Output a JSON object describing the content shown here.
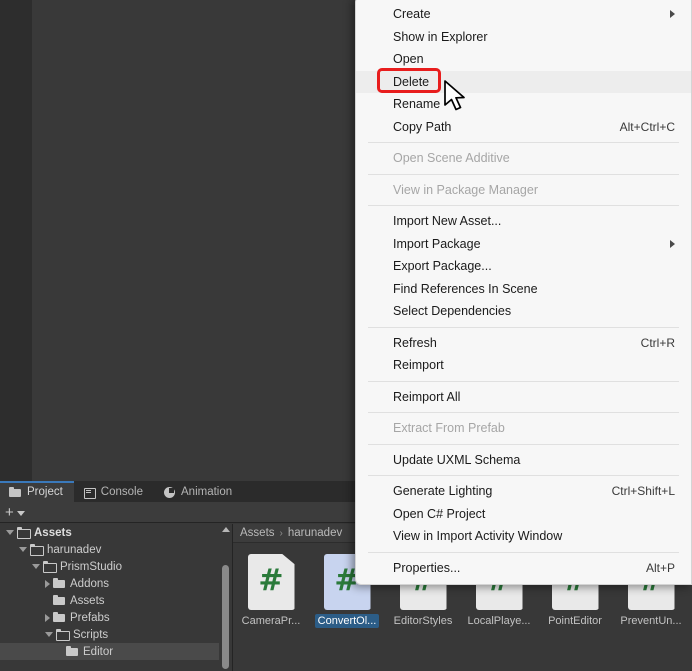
{
  "window": {
    "scene_bg_color": "#393939",
    "panel_bg_color": "#2d2d2d"
  },
  "dock": {
    "tabs": [
      {
        "label": "Project",
        "icon": "folder-icon",
        "active": true
      },
      {
        "label": "Console",
        "icon": "console-icon",
        "active": false
      },
      {
        "label": "Animation",
        "icon": "clock-icon",
        "active": false
      }
    ],
    "toolbar": {
      "create_label": "+",
      "dropdown_icon": "chevron-down-icon"
    }
  },
  "tree": {
    "items": [
      {
        "label": "Assets",
        "depth": 0,
        "twisty": "open",
        "selected": false,
        "bold": true,
        "folder": "open"
      },
      {
        "label": "harunadev",
        "depth": 1,
        "twisty": "open",
        "selected": false,
        "bold": false,
        "folder": "open"
      },
      {
        "label": "PrismStudio",
        "depth": 2,
        "twisty": "open",
        "selected": false,
        "bold": false,
        "folder": "open"
      },
      {
        "label": "Addons",
        "depth": 3,
        "twisty": "closed",
        "selected": false,
        "bold": false,
        "folder": "closed"
      },
      {
        "label": "Assets",
        "depth": 3,
        "twisty": "none",
        "selected": false,
        "bold": false,
        "folder": "closed"
      },
      {
        "label": "Prefabs",
        "depth": 3,
        "twisty": "closed",
        "selected": false,
        "bold": false,
        "folder": "closed"
      },
      {
        "label": "Scripts",
        "depth": 3,
        "twisty": "open",
        "selected": false,
        "bold": false,
        "folder": "open"
      },
      {
        "label": "Editor",
        "depth": 4,
        "twisty": "none",
        "selected": true,
        "bold": false,
        "folder": "closed"
      }
    ]
  },
  "breadcrumb": {
    "root": "Assets",
    "separator": "›",
    "current": "harunadev"
  },
  "assets": {
    "items": [
      {
        "label": "CameraPr...",
        "type": "csharp-script",
        "selected": false
      },
      {
        "label": "ConvertOl...",
        "type": "csharp-script",
        "selected": true
      },
      {
        "label": "EditorStyles",
        "type": "csharp-script",
        "selected": false
      },
      {
        "label": "LocalPlaye...",
        "type": "csharp-script",
        "selected": false
      },
      {
        "label": "PointEditor",
        "type": "csharp-script",
        "selected": false
      },
      {
        "label": "PreventUn...",
        "type": "csharp-script",
        "selected": false
      }
    ],
    "icon_glyph": "#"
  },
  "context_menu": {
    "highlight_color": "#e81d1d",
    "items": [
      {
        "kind": "item",
        "label": "Create",
        "shortcut": "",
        "submenu": true,
        "disabled": false,
        "hover": false
      },
      {
        "kind": "item",
        "label": "Show in Explorer",
        "shortcut": "",
        "submenu": false,
        "disabled": false,
        "hover": false
      },
      {
        "kind": "item",
        "label": "Open",
        "shortcut": "",
        "submenu": false,
        "disabled": false,
        "hover": false
      },
      {
        "kind": "item",
        "label": "Delete",
        "shortcut": "",
        "submenu": false,
        "disabled": false,
        "hover": true
      },
      {
        "kind": "item",
        "label": "Rename",
        "shortcut": "",
        "submenu": false,
        "disabled": false,
        "hover": false
      },
      {
        "kind": "item",
        "label": "Copy Path",
        "shortcut": "Alt+Ctrl+C",
        "submenu": false,
        "disabled": false,
        "hover": false
      },
      {
        "kind": "sep"
      },
      {
        "kind": "item",
        "label": "Open Scene Additive",
        "shortcut": "",
        "submenu": false,
        "disabled": true,
        "hover": false
      },
      {
        "kind": "sep"
      },
      {
        "kind": "item",
        "label": "View in Package Manager",
        "shortcut": "",
        "submenu": false,
        "disabled": true,
        "hover": false
      },
      {
        "kind": "sep"
      },
      {
        "kind": "item",
        "label": "Import New Asset...",
        "shortcut": "",
        "submenu": false,
        "disabled": false,
        "hover": false
      },
      {
        "kind": "item",
        "label": "Import Package",
        "shortcut": "",
        "submenu": true,
        "disabled": false,
        "hover": false
      },
      {
        "kind": "item",
        "label": "Export Package...",
        "shortcut": "",
        "submenu": false,
        "disabled": false,
        "hover": false
      },
      {
        "kind": "item",
        "label": "Find References In Scene",
        "shortcut": "",
        "submenu": false,
        "disabled": false,
        "hover": false
      },
      {
        "kind": "item",
        "label": "Select Dependencies",
        "shortcut": "",
        "submenu": false,
        "disabled": false,
        "hover": false
      },
      {
        "kind": "sep"
      },
      {
        "kind": "item",
        "label": "Refresh",
        "shortcut": "Ctrl+R",
        "submenu": false,
        "disabled": false,
        "hover": false
      },
      {
        "kind": "item",
        "label": "Reimport",
        "shortcut": "",
        "submenu": false,
        "disabled": false,
        "hover": false
      },
      {
        "kind": "sep"
      },
      {
        "kind": "item",
        "label": "Reimport All",
        "shortcut": "",
        "submenu": false,
        "disabled": false,
        "hover": false
      },
      {
        "kind": "sep"
      },
      {
        "kind": "item",
        "label": "Extract From Prefab",
        "shortcut": "",
        "submenu": false,
        "disabled": true,
        "hover": false
      },
      {
        "kind": "sep"
      },
      {
        "kind": "item",
        "label": "Update UXML Schema",
        "shortcut": "",
        "submenu": false,
        "disabled": false,
        "hover": false
      },
      {
        "kind": "sep"
      },
      {
        "kind": "item",
        "label": "Generate Lighting",
        "shortcut": "Ctrl+Shift+L",
        "submenu": false,
        "disabled": false,
        "hover": false
      },
      {
        "kind": "item",
        "label": "Open C# Project",
        "shortcut": "",
        "submenu": false,
        "disabled": false,
        "hover": false
      },
      {
        "kind": "item",
        "label": "View in Import Activity Window",
        "shortcut": "",
        "submenu": false,
        "disabled": false,
        "hover": false
      },
      {
        "kind": "sep"
      },
      {
        "kind": "item",
        "label": "Properties...",
        "shortcut": "Alt+P",
        "submenu": false,
        "disabled": false,
        "hover": false
      }
    ]
  }
}
